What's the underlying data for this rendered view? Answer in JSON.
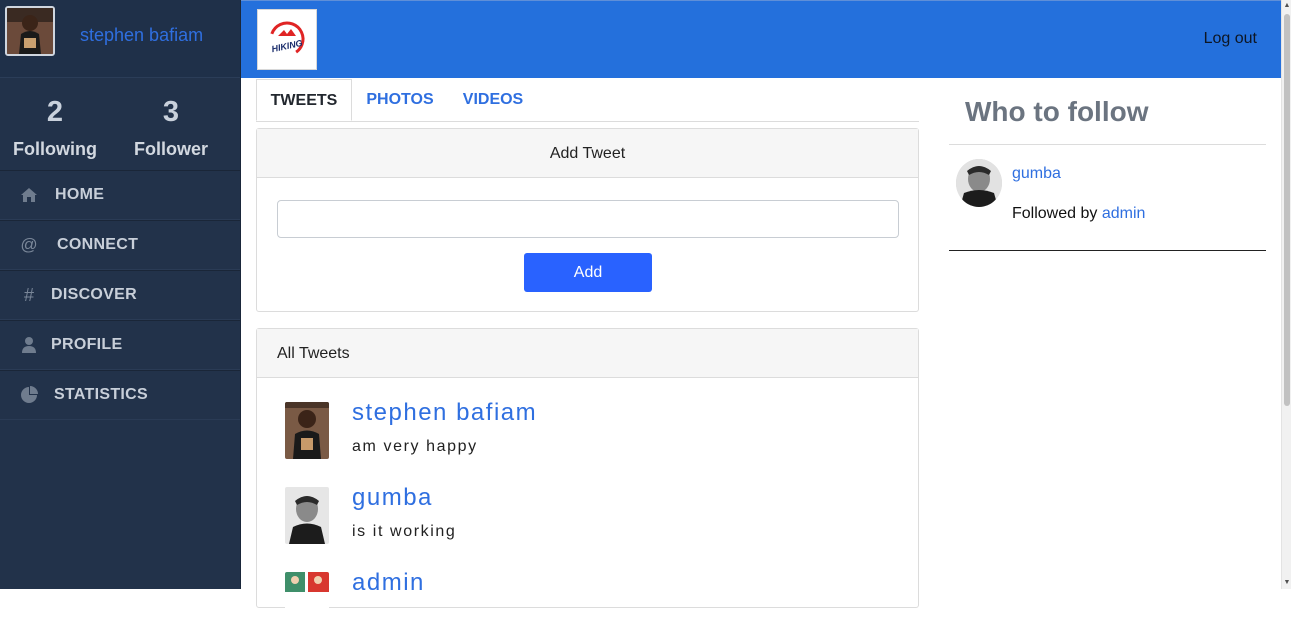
{
  "sidebar": {
    "username": "stephen bafiam",
    "stats": [
      {
        "count": "2",
        "label": "Following"
      },
      {
        "count": "3",
        "label": "Follower"
      }
    ],
    "items": [
      {
        "label": "HOME",
        "icon": "home-icon"
      },
      {
        "label": "CONNECT",
        "icon": "at-icon"
      },
      {
        "label": "DISCOVER",
        "icon": "hash-icon"
      },
      {
        "label": "PROFILE",
        "icon": "user-icon"
      },
      {
        "label": "STATISTICS",
        "icon": "pie-chart-icon"
      }
    ]
  },
  "topbar": {
    "logo_text": "HIKING",
    "logout_label": "Log out"
  },
  "tabs": [
    {
      "label": "TWEETS"
    },
    {
      "label": "PHOTOS"
    },
    {
      "label": "VIDEOS"
    }
  ],
  "add_tweet": {
    "title": "Add Tweet",
    "input_value": "",
    "button_label": "Add"
  },
  "all_tweets": {
    "title": "All Tweets",
    "items": [
      {
        "name": "stephen bafiam",
        "text": "am very happy"
      },
      {
        "name": "gumba",
        "text": "is it working"
      },
      {
        "name": "admin",
        "text": ""
      }
    ]
  },
  "who_to_follow": {
    "title": "Who to follow",
    "user": "gumba",
    "followed_by_prefix": "Followed by",
    "followed_by_user": "admin"
  },
  "colors": {
    "accent": "#2470dc",
    "link": "#2f6fe0",
    "sidebar": "#22324a",
    "button": "#2962ff"
  }
}
